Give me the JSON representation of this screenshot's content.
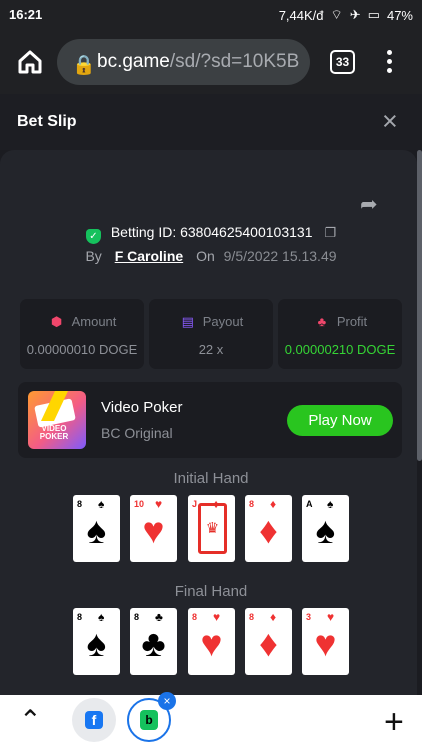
{
  "status": {
    "time": "16:21",
    "network": "7,44K/đ",
    "battery": "47%"
  },
  "browser": {
    "url_domain": "bc.game",
    "url_path": "/sd/?sd=10K5B",
    "tab_count": "33"
  },
  "bet_slip": {
    "title": "Bet Slip",
    "betting_label": "Betting ID:",
    "betting_id": "63804625400103131",
    "by_label": "By",
    "user": "F Caroline",
    "on_label": "On",
    "date": "9/5/2022 15.13.49"
  },
  "stats": [
    {
      "label": "Amount",
      "value": "0.00000010 DOGE",
      "icon": "coins-icon",
      "color": "#f0466b"
    },
    {
      "label": "Payout",
      "value": "22 x",
      "icon": "wallet-icon",
      "color": "#8b5cff"
    },
    {
      "label": "Profit",
      "value": "0.00000210 DOGE",
      "icon": "profit-icon",
      "color": "#f0466b"
    }
  ],
  "game": {
    "logo_text": "VIDEO POKER",
    "name": "Video Poker",
    "subtitle": "BC Original",
    "button": "Play Now"
  },
  "initial_hand": {
    "title": "Initial Hand",
    "cards": [
      {
        "rank": "8",
        "suit": "♠",
        "color": "black"
      },
      {
        "rank": "10",
        "suit": "♥",
        "color": "red"
      },
      {
        "rank": "J",
        "suit": "♦",
        "color": "red"
      },
      {
        "rank": "8",
        "suit": "♦",
        "color": "red"
      },
      {
        "rank": "A",
        "suit": "♠",
        "color": "black"
      }
    ]
  },
  "final_hand": {
    "title": "Final Hand",
    "cards": [
      {
        "rank": "8",
        "suit": "♠",
        "color": "black"
      },
      {
        "rank": "8",
        "suit": "♣",
        "color": "black"
      },
      {
        "rank": "8",
        "suit": "♥",
        "color": "red"
      },
      {
        "rank": "8",
        "suit": "♦",
        "color": "red"
      },
      {
        "rank": "3",
        "suit": "♥",
        "color": "red"
      }
    ]
  },
  "bottom_bar": {
    "up": "⌃",
    "plus": "+"
  }
}
